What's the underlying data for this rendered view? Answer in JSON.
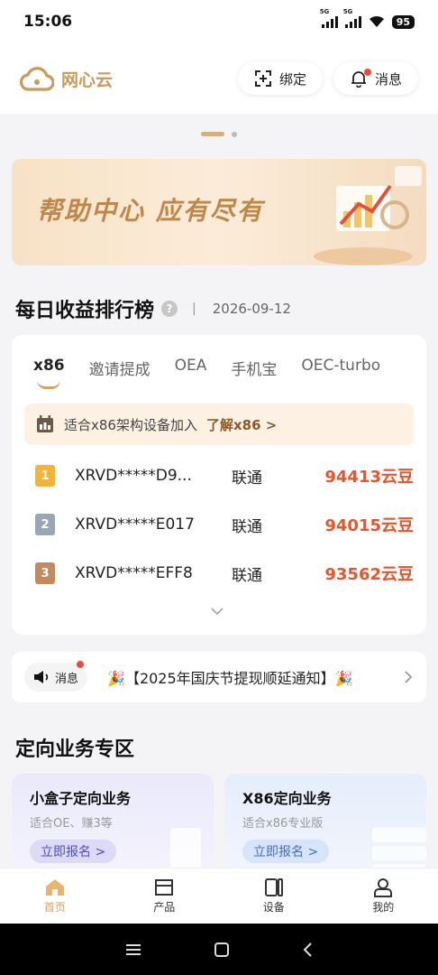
{
  "status": {
    "time": "15:06",
    "net1": "5G",
    "net2": "5G",
    "battery": "95"
  },
  "header": {
    "brand": "网心云",
    "bind_label": "绑定",
    "msg_label": "消息"
  },
  "banner": {
    "title": "帮助中心  应有尽有"
  },
  "ranking": {
    "title": "每日收益排行榜",
    "help": "?",
    "separator": "|",
    "date": "2026-09-12",
    "tabs": [
      "x86",
      "邀请提成",
      "OEA",
      "手机宝",
      "OEC-turbo"
    ],
    "notice": "适合x86架构设备加入",
    "notice_link": "了解x86 >",
    "rows": [
      {
        "rank": "1",
        "device": "XRVD*****D9...",
        "isp": "联通",
        "points": "94413云豆",
        "color": "#f2b53a"
      },
      {
        "rank": "2",
        "device": "XRVD*****E017",
        "isp": "联通",
        "points": "94015云豆",
        "color": "#9aa5b5"
      },
      {
        "rank": "3",
        "device": "XRVD*****EFF8",
        "isp": "联通",
        "points": "93562云豆",
        "color": "#c28a5e"
      }
    ]
  },
  "message": {
    "pill_label": "消息",
    "text": "🎉【2025年国庆节提现顺延通知】🎉"
  },
  "business": {
    "title": "定向业务专区",
    "cards": [
      {
        "title": "小盒子定向业务",
        "subtitle": "适合OE、赚3等",
        "button": "立即报名 >"
      },
      {
        "title": "X86定向业务",
        "subtitle": "适合x86专业版",
        "button": "立即报名 >"
      }
    ]
  },
  "nav": {
    "home": "首页",
    "products": "产品",
    "devices": "设备",
    "mine": "我的"
  },
  "colors": {
    "accent": "#d3a05f",
    "points": "#e8552d",
    "badge": "#e84c3d"
  }
}
